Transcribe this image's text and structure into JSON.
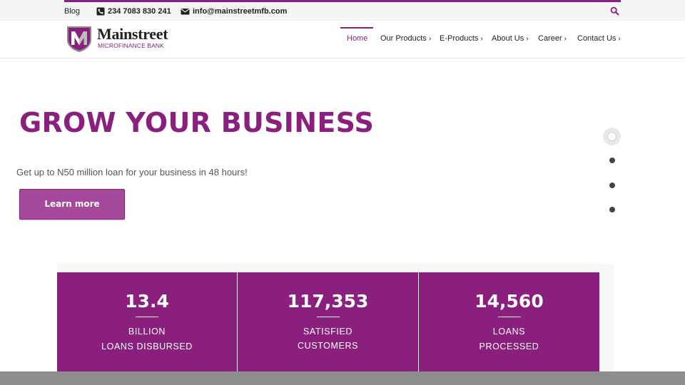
{
  "topbar": {
    "blog_label": "Blog",
    "phone": "234 7083 830 241",
    "email": "info@mainstreetmfb.com",
    "phone_icon": "phone-icon",
    "email_icon": "envelope-icon",
    "search_icon": "search-icon"
  },
  "logo": {
    "name": "Mainstreet",
    "subtitle": "MICROFINANCE BANK"
  },
  "nav": {
    "items": [
      {
        "label": "Home",
        "active": true
      },
      {
        "label": "Our Products",
        "has_dropdown": true
      },
      {
        "label": "E-Products",
        "has_dropdown": true
      },
      {
        "label": "About Us",
        "has_dropdown": true
      },
      {
        "label": "Career",
        "has_dropdown": true
      },
      {
        "label": "Contact Us",
        "has_dropdown": true
      }
    ]
  },
  "hero": {
    "title": "GROW YOUR BUSINESS",
    "subtitle": "Get up to N50 million loan for your business in 48 hours!",
    "button_label": "Learn more",
    "slide_count": 4,
    "active_slide": 1
  },
  "stats": [
    {
      "value": "13.4",
      "line1": "BILLION",
      "line2": "LOANS DISBURSED"
    },
    {
      "value": "117,353",
      "line1": "SATISFIED",
      "line2": "CUSTOMERS"
    },
    {
      "value": "14,560",
      "line1": "LOANS",
      "line2": "PROCESSED"
    }
  ],
  "colors": {
    "brand": "#8a1f7e",
    "button": "#a6499c",
    "topbar_bg": "#f4f4f4"
  }
}
